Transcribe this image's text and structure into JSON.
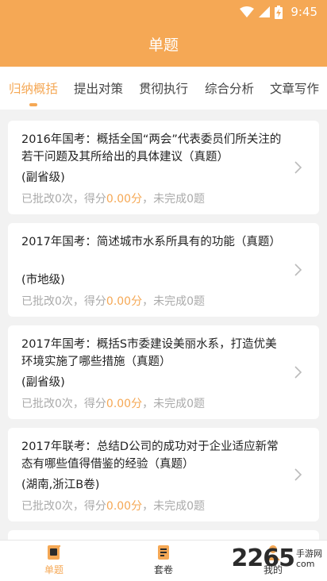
{
  "status": {
    "time": "9:45"
  },
  "header": {
    "title": "单题"
  },
  "tabs": [
    {
      "label": "归纳概括",
      "active": true
    },
    {
      "label": "提出对策",
      "active": false
    },
    {
      "label": "贯彻执行",
      "active": false
    },
    {
      "label": "综合分析",
      "active": false
    },
    {
      "label": "文章写作",
      "active": false
    }
  ],
  "cards": [
    {
      "title": "2016年国考：概括全国“两会”代表委员们所关注的若干问题及其所给出的具体建议（真题）",
      "region": "(副省级)",
      "stats_pre": "已批改0次，得分",
      "score": "0.00分",
      "stats_post": "，未完成0题"
    },
    {
      "title": "2017年国考：简述城市水系所具有的功能（真题）",
      "region": "(市地级)",
      "stats_pre": "已批改0次，得分",
      "score": "0.00分",
      "stats_post": "，未完成0题"
    },
    {
      "title": "2017年国考：概括S市委建设美丽水系，打造优美环境实施了哪些措施（真题）",
      "region": "(副省级)",
      "stats_pre": "已批改0次，得分",
      "score": "0.00分",
      "stats_post": "，未完成0题"
    },
    {
      "title": "2017年联考：总结D公司的成功对于企业适应新常态有哪些值得借鉴的经验（真题）",
      "region": "(湖南,浙江B卷)",
      "stats_pre": "已批改0次，得分",
      "score": "0.00分",
      "stats_post": "，未完成0题"
    }
  ],
  "bottom_nav": [
    {
      "label": "单题",
      "icon": "single-question-icon",
      "active": true
    },
    {
      "label": "套卷",
      "icon": "exam-set-icon",
      "active": false
    },
    {
      "label": "我的",
      "icon": "profile-icon",
      "active": false
    }
  ],
  "watermark": {
    "number": "2265",
    "line1": "手游网",
    "line2": "com"
  },
  "colors": {
    "accent": "#f5a855",
    "background": "#f2f2f2"
  }
}
